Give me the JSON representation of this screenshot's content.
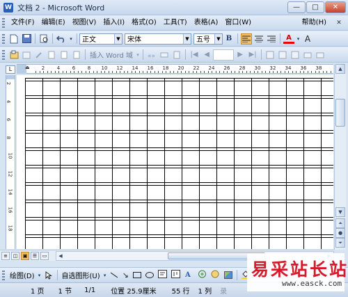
{
  "window": {
    "title": "文档 2 - Microsoft Word",
    "app_icon": "W",
    "min": "—",
    "max": "□",
    "close": "✕"
  },
  "menu": {
    "items": [
      "文件(F)",
      "编辑(E)",
      "视图(V)",
      "插入(I)",
      "格式(O)",
      "工具(T)",
      "表格(A)",
      "窗口(W)"
    ],
    "help": "帮助(H)",
    "close": "✕"
  },
  "formatting": {
    "style": "正文",
    "font": "宋体",
    "size": "五号",
    "bold": "B",
    "font_color_glyph": "A",
    "font_size_glyph": "A"
  },
  "toolbar2": {
    "insert_word_field": "插入 Word 域"
  },
  "ruler": {
    "h_numbers": [
      "2",
      "4",
      "6",
      "8",
      "10",
      "12",
      "14",
      "16",
      "18",
      "20",
      "22",
      "24",
      "26",
      "28",
      "30",
      "32",
      "34",
      "36",
      "38"
    ],
    "v_numbers": [
      "2",
      "4",
      "6",
      "8",
      "10",
      "12",
      "14",
      "16",
      "18"
    ],
    "corner": "L"
  },
  "drawing": {
    "draw_menu": "绘图(D)",
    "autoshapes": "自选图形(U)"
  },
  "status": {
    "page": "1 页",
    "section": "1 节",
    "page_of": "1/1",
    "position": "位置 25.9厘米",
    "line": "55 行",
    "column": "1 列",
    "rec": "录"
  },
  "watermark": {
    "text_cn": "易采站长站",
    "url": "www.easck.com"
  },
  "icons": {
    "new": "new-document-icon",
    "open": "open-folder-icon",
    "save": "save-disk-icon",
    "preview": "print-preview-icon",
    "undo": "undo-icon",
    "align_left": "align-left-icon",
    "align_center": "align-center-icon",
    "align_right": "align-right-icon"
  },
  "grid": {
    "cols": 17,
    "rows": 11,
    "row_pattern": "double-line separators"
  }
}
